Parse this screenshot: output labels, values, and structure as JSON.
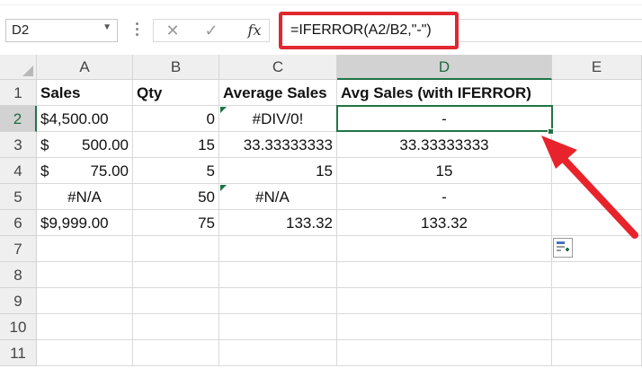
{
  "formula_bar": {
    "name_box": "D2",
    "cancel_glyph": "✕",
    "enter_glyph": "✓",
    "fx_label": "fx",
    "formula": "=IFERROR(A2/B2,\"-\")"
  },
  "columns": [
    "A",
    "B",
    "C",
    "D",
    "E"
  ],
  "rows": [
    "1",
    "2",
    "3",
    "4",
    "5",
    "6",
    "7",
    "8",
    "9",
    "10",
    "11"
  ],
  "selected_cell": "D2",
  "headers": {
    "a": "Sales",
    "b": "Qty",
    "c": "Average Sales",
    "d": "Avg Sales (with IFERROR)"
  },
  "data_rows": [
    {
      "a": "$4,500.00",
      "a_currency": "",
      "a_amount": "",
      "b": "0",
      "c": "#DIV/0!",
      "d": "-"
    },
    {
      "a": "",
      "a_currency": "$",
      "a_amount": "500.00",
      "b": "15",
      "c": "33.33333333",
      "d": "33.33333333"
    },
    {
      "a": "",
      "a_currency": "$",
      "a_amount": "75.00",
      "b": "5",
      "c": "15",
      "d": "15"
    },
    {
      "a": "#N/A",
      "a_currency": "",
      "a_amount": "",
      "b": "50",
      "c": "#N/A",
      "d": "-"
    },
    {
      "a": "$9,999.00",
      "a_currency": "",
      "a_amount": "",
      "b": "75",
      "c": "133.32",
      "d": "133.32"
    }
  ],
  "colors": {
    "excel_green": "#217346",
    "highlight_red": "#e0282f"
  },
  "icons": [
    "chevron-down-icon",
    "cancel-icon",
    "enter-icon",
    "fx-icon",
    "quick-analysis-icon",
    "red-arrow-annotation"
  ]
}
